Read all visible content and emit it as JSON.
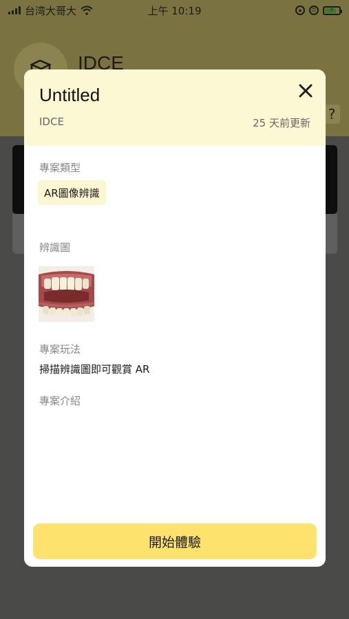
{
  "status_bar": {
    "carrier": "台湾大哥大",
    "time": "上午 10:19",
    "icons": [
      "signal-icon",
      "wifi-icon",
      "orientation-lock-icon",
      "alarm-icon",
      "battery-charging-icon"
    ]
  },
  "background": {
    "app_title": "IDCE",
    "help_glyph": "?"
  },
  "modal": {
    "title": "Untitled",
    "author": "IDCE",
    "updated": "25 天前更新",
    "project_type_label": "專案類型",
    "project_type_value": "AR圖像辨識",
    "marker_label": "辨識圖",
    "play_label": "專案玩法",
    "play_text": "掃描辨識圖即可觀賞 AR",
    "intro_label": "專案介紹",
    "start_button": "開始體驗"
  },
  "colors": {
    "header_bg": "#fdf8d4",
    "chip_bg": "#fcf6d2",
    "button_bg": "#fde36e"
  }
}
